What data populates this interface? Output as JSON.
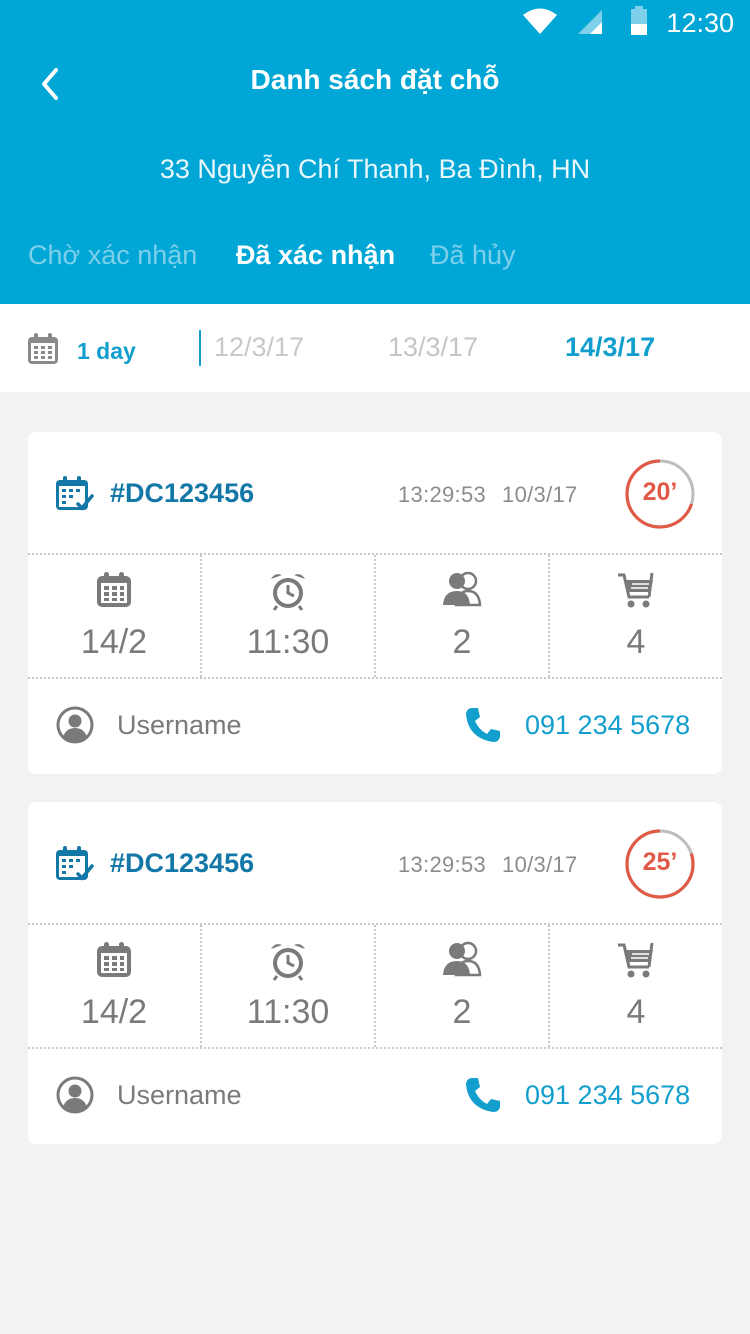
{
  "status_bar": {
    "time": "12:30"
  },
  "header": {
    "title": "Danh sách đặt chỗ",
    "address": "33 Nguyễn Chí Thanh, Ba Đình, HN"
  },
  "tabs": [
    {
      "label": "Chờ xác nhận",
      "active": false
    },
    {
      "label": "Đã xác nhận",
      "active": true
    },
    {
      "label": "Đã hủy",
      "active": false
    }
  ],
  "date_filter": {
    "range_label": "1 day",
    "dates": [
      "12/3/17",
      "13/3/17",
      "14/3/17"
    ],
    "selected": "14/3/17"
  },
  "bookings": [
    {
      "code": "#DC123456",
      "time": "13:29:53",
      "date": "10/3/17",
      "timer": "20’",
      "timer_progress": 0.7,
      "day": "14/2",
      "hour": "11:30",
      "guests": "2",
      "items": "4",
      "user": "Username",
      "phone": "091 234 5678"
    },
    {
      "code": "#DC123456",
      "time": "13:29:53",
      "date": "10/3/17",
      "timer": "25’",
      "timer_progress": 0.8,
      "day": "14/2",
      "hour": "11:30",
      "guests": "2",
      "items": "4",
      "user": "Username",
      "phone": "091 234 5678"
    }
  ],
  "colors": {
    "header_bg": "#00a7d6",
    "accent": "#139fcd",
    "code": "#1378a7",
    "timer": "#e05a47"
  }
}
